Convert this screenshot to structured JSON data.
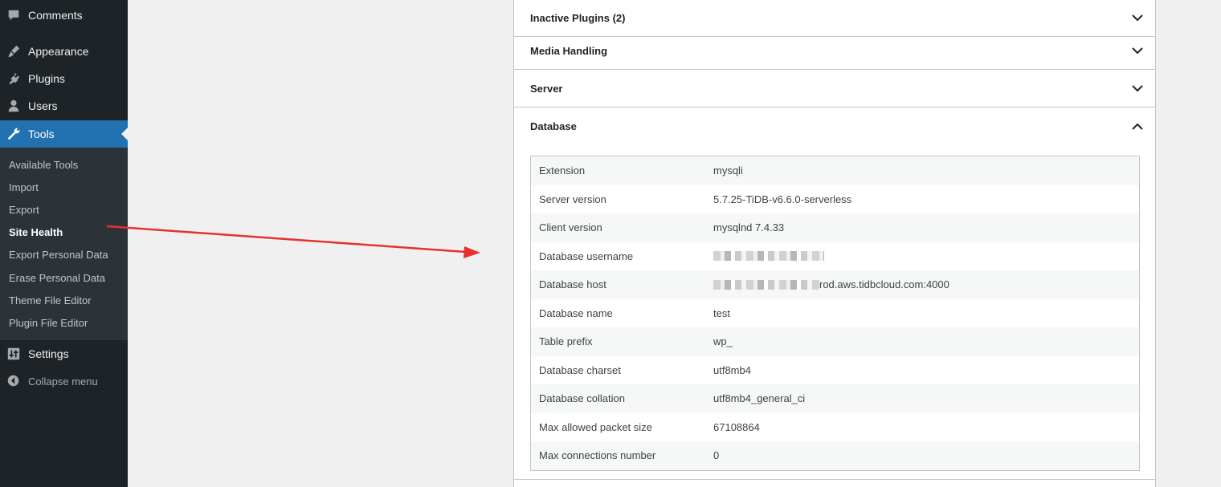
{
  "sidebar": {
    "menu": [
      {
        "label": "Comments",
        "icon": "comments-icon"
      },
      {
        "label": "Appearance",
        "icon": "appearance-icon"
      },
      {
        "label": "Plugins",
        "icon": "plugins-icon"
      },
      {
        "label": "Users",
        "icon": "users-icon"
      },
      {
        "label": "Tools",
        "icon": "tools-icon",
        "active": true
      },
      {
        "label": "Settings",
        "icon": "settings-icon"
      }
    ],
    "tools_submenu": [
      "Available Tools",
      "Import",
      "Export",
      "Site Health",
      "Export Personal Data",
      "Erase Personal Data",
      "Theme File Editor",
      "Plugin File Editor"
    ],
    "current_submenu": "Site Health",
    "collapse_label": "Collapse menu"
  },
  "accordion": {
    "sections": [
      {
        "title": "Inactive Plugins (2)",
        "expanded": false
      },
      {
        "title": "Media Handling",
        "expanded": false
      },
      {
        "title": "Server",
        "expanded": false
      },
      {
        "title": "Database",
        "expanded": true
      }
    ]
  },
  "database": {
    "rows": [
      {
        "label": "Extension",
        "value": "mysqli"
      },
      {
        "label": "Server version",
        "value": "5.7.25-TiDB-v6.6.0-serverless"
      },
      {
        "label": "Client version",
        "value": "mysqlnd 7.4.33"
      },
      {
        "label": "Database username",
        "value": "",
        "redacted": true
      },
      {
        "label": "Database host",
        "value": "rod.aws.tidbcloud.com:4000",
        "redacted": true
      },
      {
        "label": "Database name",
        "value": "test"
      },
      {
        "label": "Table prefix",
        "value": "wp_"
      },
      {
        "label": "Database charset",
        "value": "utf8mb4"
      },
      {
        "label": "Database collation",
        "value": "utf8mb4_general_ci"
      },
      {
        "label": "Max allowed packet size",
        "value": "67108864"
      },
      {
        "label": "Max connections number",
        "value": "0"
      }
    ]
  },
  "colors": {
    "sidebar_bg": "#1d2327",
    "submenu_bg": "#2c3338",
    "active_bg": "#2271b1",
    "annotation_arrow": "#e8312f"
  }
}
